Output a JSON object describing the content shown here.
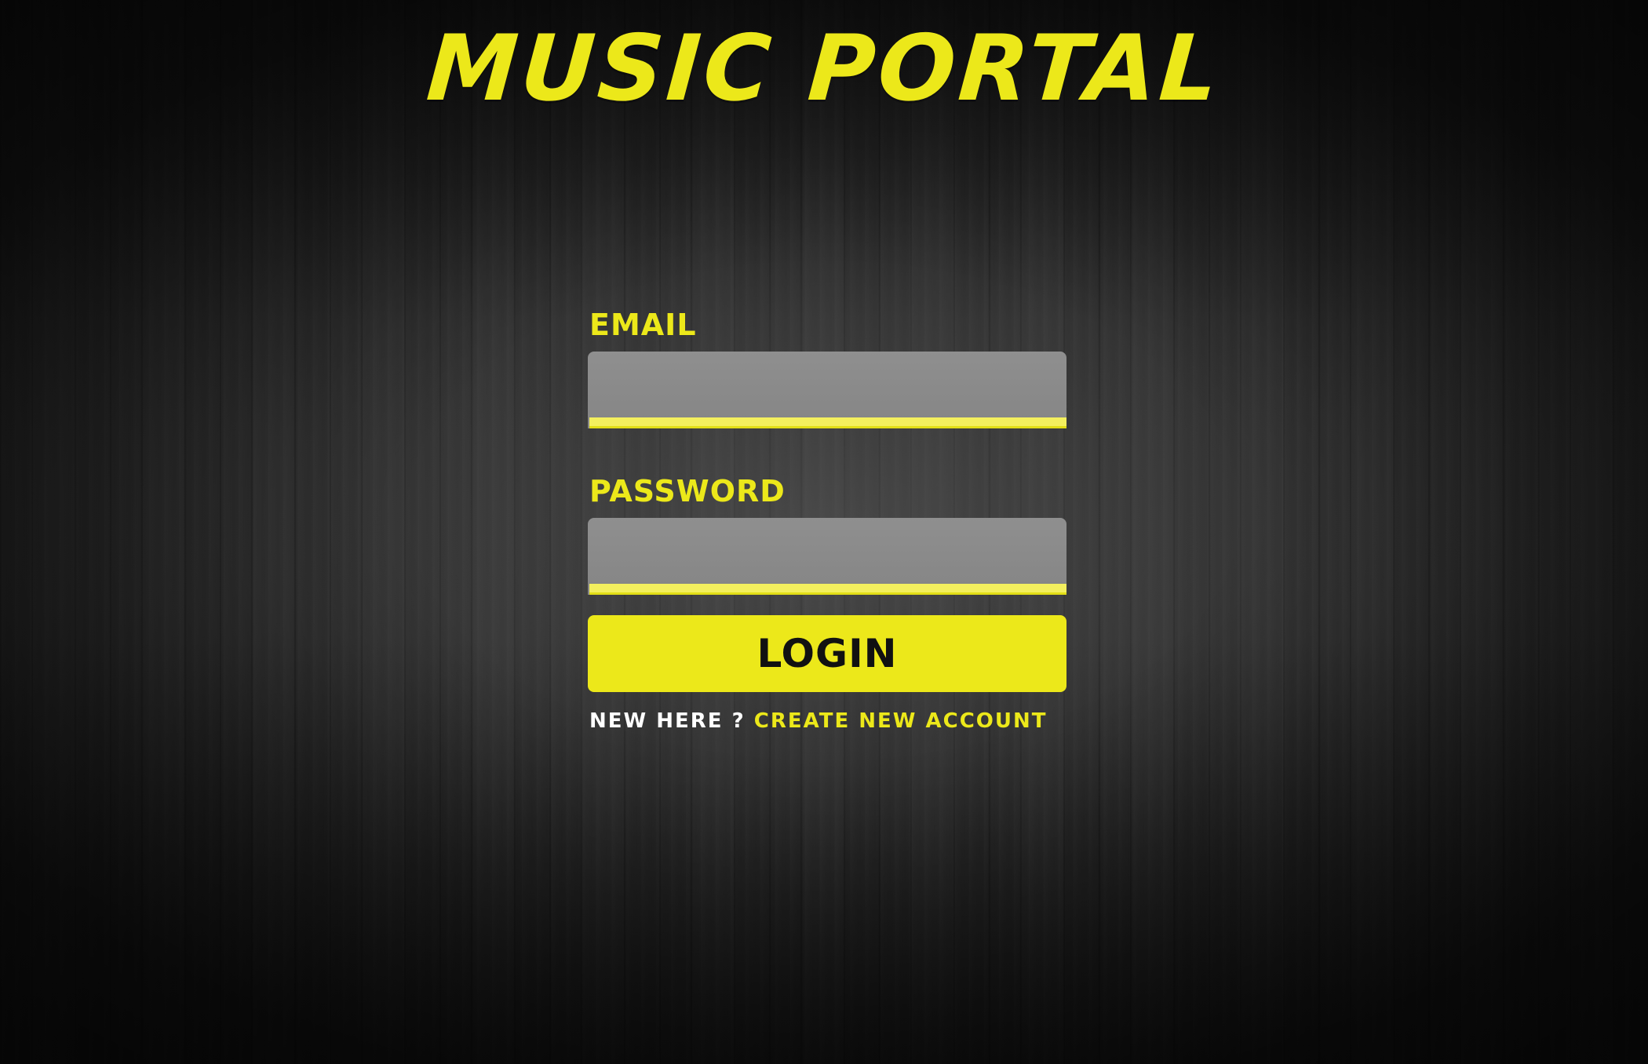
{
  "app": {
    "title": "MUSIC PORTAL"
  },
  "login_form": {
    "email_label": "EMAIL",
    "email_value": "",
    "password_label": "PASSWORD",
    "password_value": "",
    "submit_label": "LOGIN",
    "signup_prompt": "NEW HERE ?",
    "signup_link": "CREATE NEW ACCOUNT"
  },
  "colors": {
    "accent": "#ece81a",
    "input_bg": "#8a8a8a",
    "input_underline": "#f3ef5e",
    "prompt_text": "#ffffff",
    "button_text": "#111111"
  }
}
